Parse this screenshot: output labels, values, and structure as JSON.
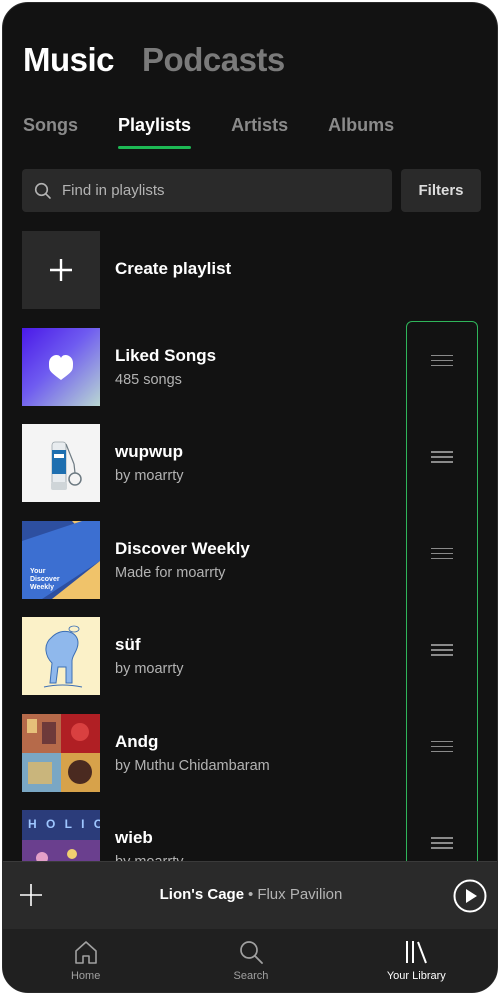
{
  "header": {
    "tabs": [
      {
        "label": "Music",
        "active": true
      },
      {
        "label": "Podcasts",
        "active": false
      }
    ]
  },
  "subtabs": [
    {
      "label": "Songs",
      "active": false
    },
    {
      "label": "Playlists",
      "active": true
    },
    {
      "label": "Artists",
      "active": false
    },
    {
      "label": "Albums",
      "active": false
    }
  ],
  "search": {
    "placeholder": "Find in playlists",
    "value": ""
  },
  "filters_label": "Filters",
  "create_playlist_label": "Create playlist",
  "playlists": [
    {
      "title": "Liked Songs",
      "subtitle": "485 songs",
      "art": "liked-songs-heart"
    },
    {
      "title": "wupwup",
      "subtitle": "by moarrty",
      "art": "inhaler-tube"
    },
    {
      "title": "Discover Weekly",
      "subtitle": "Made for moarrty",
      "art_text": [
        "Your",
        "Discover",
        "Weekly"
      ]
    },
    {
      "title": "süf",
      "subtitle": "by moarrty",
      "art": "blue-figure-drawing"
    },
    {
      "title": "Andg",
      "subtitle": "by Muthu Chidambaram",
      "art": "photo-collage"
    },
    {
      "title": "wieb",
      "subtitle": "by moarrty",
      "art": "neon-street-holic"
    }
  ],
  "now_playing": {
    "song": "Lion's Cage",
    "separator": "•",
    "artist": "Flux Pavilion"
  },
  "nav": [
    {
      "label": "Home",
      "icon": "home-icon",
      "active": false
    },
    {
      "label": "Search",
      "icon": "search-icon",
      "active": false
    },
    {
      "label": "Your Library",
      "icon": "library-icon",
      "active": true
    }
  ],
  "colors": {
    "background": "#121212",
    "accent": "#1db954",
    "surface": "#2a2a2a",
    "highlight_box": "#2fb55a"
  }
}
